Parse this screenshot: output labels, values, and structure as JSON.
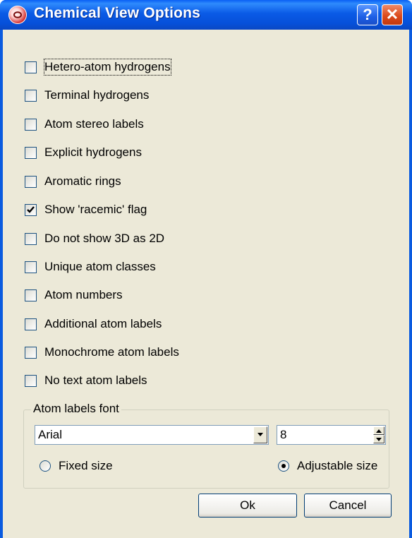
{
  "window": {
    "title": "Chemical View Options",
    "help_label": "?",
    "close_label": "✕"
  },
  "options": [
    {
      "label": "Hetero-atom hydrogens",
      "checked": false
    },
    {
      "label": "Terminal hydrogens",
      "checked": false
    },
    {
      "label": "Atom stereo labels",
      "checked": false
    },
    {
      "label": "Explicit hydrogens",
      "checked": false
    },
    {
      "label": "Aromatic rings",
      "checked": false
    },
    {
      "label": "Show 'racemic' flag",
      "checked": true
    },
    {
      "label": "Do not show 3D as 2D",
      "checked": false
    },
    {
      "label": "Unique atom classes",
      "checked": false
    },
    {
      "label": "Atom numbers",
      "checked": false
    },
    {
      "label": "Additional atom labels",
      "checked": false
    },
    {
      "label": "Monochrome atom labels",
      "checked": false
    },
    {
      "label": "No text atom labels",
      "checked": false
    }
  ],
  "font_group": {
    "title": "Atom labels font",
    "font_value": "Arial",
    "size_value": "8",
    "fixed_size_label": "Fixed size",
    "adjustable_size_label": "Adjustable size",
    "selected_mode": "adjustable"
  },
  "buttons": {
    "ok_label": "Ok",
    "cancel_label": "Cancel"
  }
}
